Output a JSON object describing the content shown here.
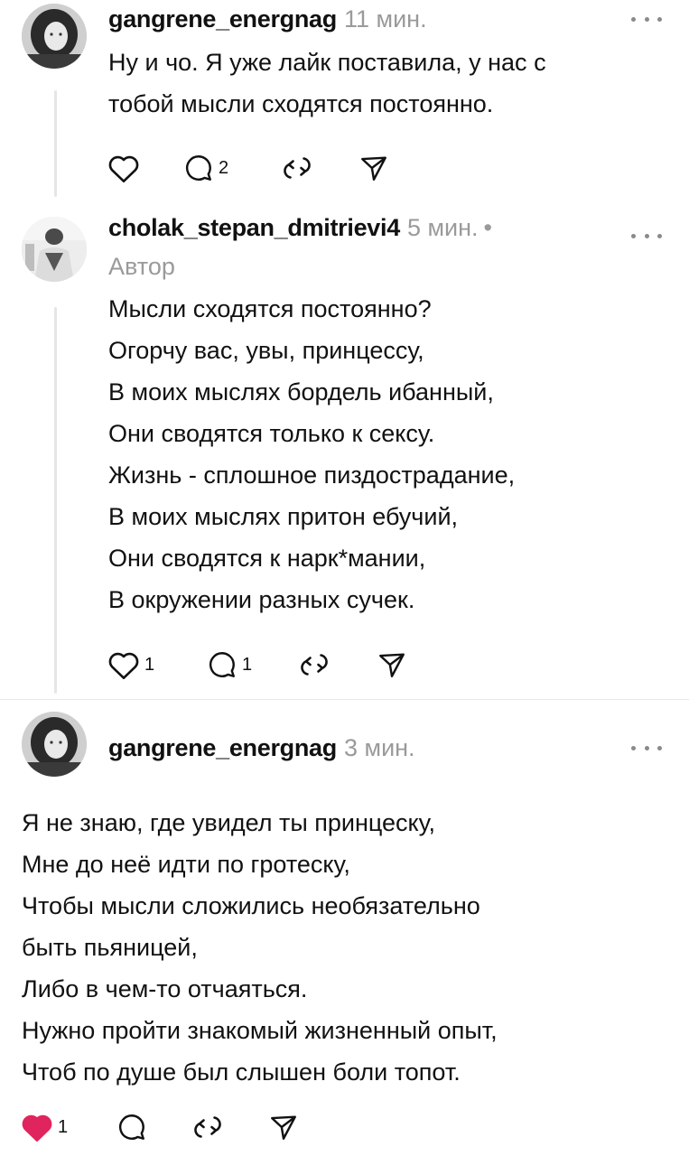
{
  "colors": {
    "text": "#111111",
    "muted": "#9a9a9a",
    "thread": "#e6e6e6",
    "like_active": "#e0245e"
  },
  "posts": [
    {
      "username": "gangrene_energnag",
      "time": "11 мин.",
      "lines": [
        "Ну и чо. Я уже лайк поставила, у нас с",
        "тобой мысли сходятся постоянно."
      ],
      "reply_count": "2"
    },
    {
      "username": "cholak_stepan_dmitrievi4",
      "time": "5 мин.",
      "separator": "•",
      "badge": "Автор",
      "lines": [
        "Мысли сходятся постоянно?",
        "Огорчу вас, увы, принцессу,",
        "В моих мыслях бордель ибанный,",
        "Они сводятся только к сексу.",
        "Жизнь - сплошное пиздострадание,",
        "В моих мыслях притон ебучий,",
        "Они сводятся к нарк*мании,",
        "В окружении разных сучек."
      ],
      "like_count": "1",
      "reply_count": "1"
    },
    {
      "username": "gangrene_energnag",
      "time": "3 мин.",
      "lines": [
        "Я не знаю, где увидел ты принцеску,",
        "Мне до неё идти по гротеску,",
        "Чтобы мысли сложились необязательно",
        "быть пьяницей,",
        "Либо в чем-то отчаяться.",
        "Нужно пройти знакомый жизненный опыт,",
        "Чтоб по душе был слышен боли топот."
      ],
      "like_count": "1",
      "liked": true
    }
  ],
  "icons": {
    "like": "heart-icon",
    "reply": "comment-bubble-icon",
    "repost": "repost-icon",
    "share": "send-icon",
    "more": "more-dots-icon"
  }
}
